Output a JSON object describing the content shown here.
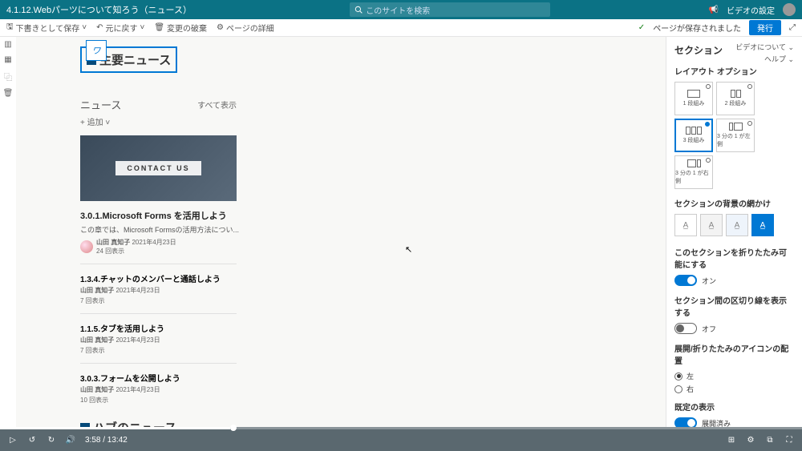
{
  "header": {
    "title": "4.1.12.Webパーツについて知ろう（ニュース）",
    "search_placeholder": "このサイトを検索",
    "video_settings": "ビデオの設定"
  },
  "toolbar": {
    "save_draft": "下書きとして保存",
    "undo": "元に戻す",
    "discard": "変更の破棄",
    "page_details": "ページの詳細",
    "saved_msg": "ページが保存されました",
    "publish": "発行"
  },
  "badge": "ワ",
  "content": {
    "main_title": "主要ニュース",
    "news_label": "ニュース",
    "show_all": "すべて表示",
    "add": "+ 追加",
    "hero": {
      "overlay": "CONTACT US",
      "title": "3.0.1.Microsoft Forms を活用しよう",
      "desc": "この章では、Microsoft Formsの活用方法につい...",
      "author": "山田 真知子",
      "date": "2021年4月23日",
      "views": "24 回表示"
    },
    "items": [
      {
        "title": "1.3.4.チャットのメンバーと通話しよう",
        "author": "山田 真知子",
        "date": "2021年4月23日",
        "views": "7 回表示"
      },
      {
        "title": "1.1.5.タブを活用しよう",
        "author": "山田 真知子",
        "date": "2021年4月23日",
        "views": "7 回表示"
      },
      {
        "title": "3.0.3.フォームを公開しよう",
        "author": "山田 真知子",
        "date": "2021年4月23日",
        "views": "10 回表示"
      }
    ],
    "hub_title": "ハブのニュース"
  },
  "rightpane": {
    "links": {
      "about": "ビデオについて",
      "help": "ヘルプ"
    },
    "title": "セクション",
    "layout_label": "レイアウト オプション",
    "layouts": [
      "1 段組み",
      "2 段組み",
      "3 段組み",
      "3 分の 1 が左側",
      "3 分の 1 が右側"
    ],
    "shading_label": "セクションの背景の網かけ",
    "collapse_label": "このセクションを折りたたみ可能にする",
    "collapse_on": "オン",
    "divider_label": "セクション間の区切り線を表示する",
    "divider_off": "オフ",
    "icon_pos_label": "展開/折りたたみのアイコンの配置",
    "left": "左",
    "right": "右",
    "default_label": "既定の表示",
    "expanded": "展開済み"
  },
  "video": {
    "time": "3:58 / 13:42"
  }
}
